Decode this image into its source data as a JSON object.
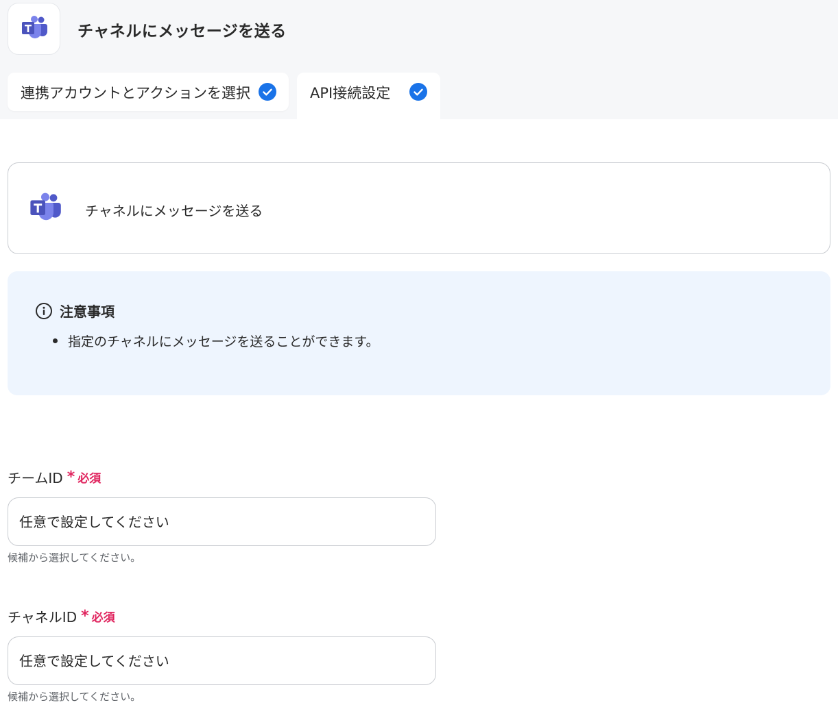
{
  "header": {
    "app_icon": "microsoft-teams-icon",
    "title": "チャネルにメッセージを送る"
  },
  "tabs": [
    {
      "label": "連携アカウントとアクションを選択",
      "status": "completed",
      "icon": "check-circle-icon"
    },
    {
      "label": "API接続設定",
      "status": "completed",
      "icon": "check-circle-icon",
      "active": true
    }
  ],
  "action_card": {
    "icon": "microsoft-teams-icon",
    "title": "チャネルにメッセージを送る"
  },
  "notice": {
    "icon": "info-icon",
    "title": "注意事項",
    "items": [
      "指定のチャネルにメッセージを送ることができます。"
    ]
  },
  "fields": [
    {
      "label": "チームID",
      "required_mark": "*",
      "required_text": "必須",
      "placeholder": "任意で設定してください",
      "help": "候補から選択してください。"
    },
    {
      "label": "チャネルID",
      "required_mark": "*",
      "required_text": "必須",
      "placeholder": "任意で設定してください",
      "help": "候補から選択してください。"
    }
  ],
  "colors": {
    "accent": "#1a73e8",
    "required": "#e0245e",
    "notice_bg": "#eef5fe",
    "teams_purple": "#5059c9"
  }
}
